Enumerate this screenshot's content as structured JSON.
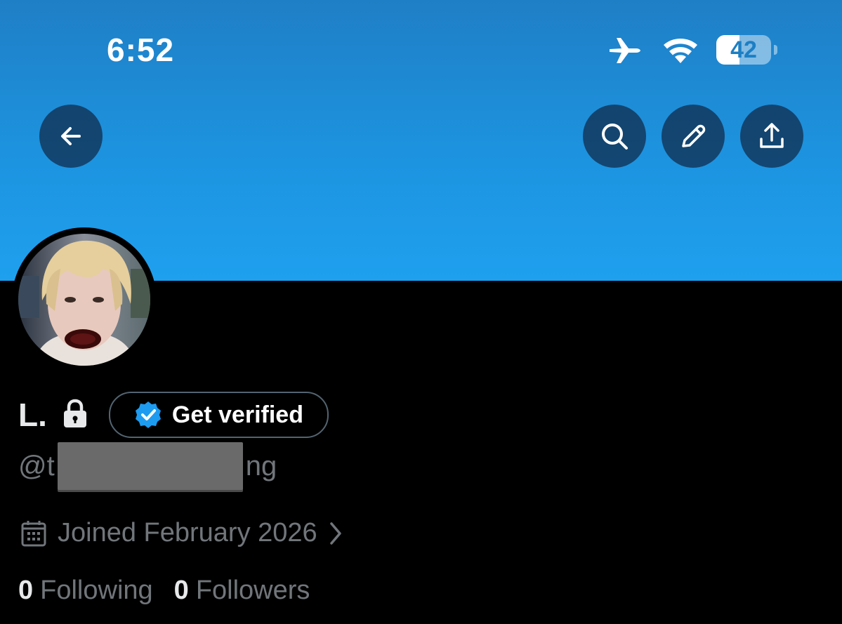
{
  "status_bar": {
    "time": "6:52",
    "battery_level": "42",
    "battery_fraction": 0.42
  },
  "header": {
    "back_icon": "arrow-left-icon",
    "actions": [
      "search-icon",
      "pencil-icon",
      "share-icon"
    ],
    "banner_color": "#1d93df"
  },
  "profile": {
    "display_name": "L.",
    "protected_icon": "lock-icon",
    "get_verified_label": "Get verified",
    "verified_badge_color": "#1d9bf0",
    "handle_start": "@t",
    "handle_end": "ng",
    "joined": "Joined February 2026",
    "following_count": "0",
    "following_label": "Following",
    "followers_count": "0",
    "followers_label": "Followers"
  }
}
